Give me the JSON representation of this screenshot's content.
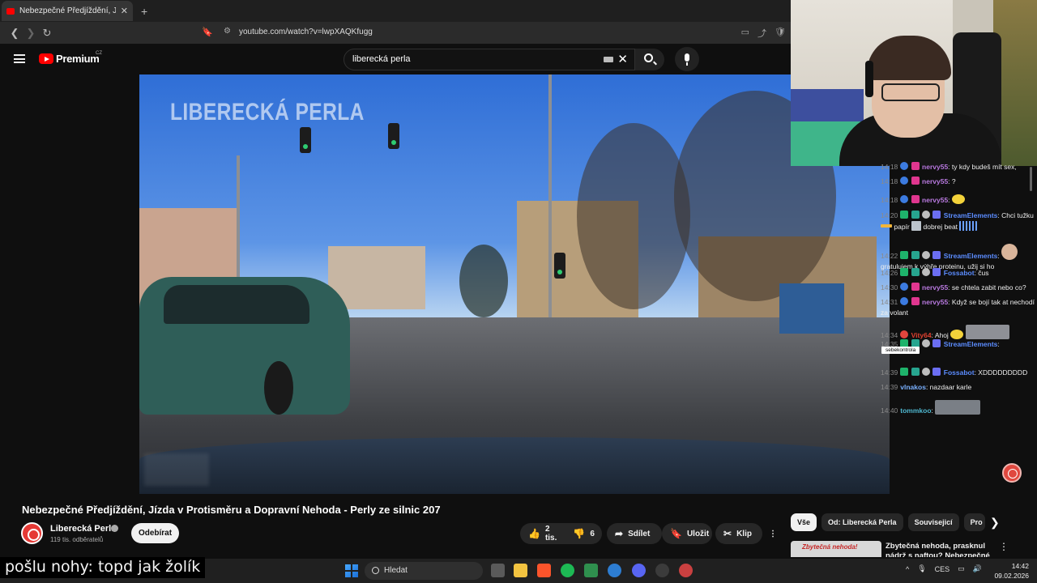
{
  "browser": {
    "tab_title": "Nebezpečné Předjíždění, Jízd",
    "tab_close": "✕",
    "new_tab": "+",
    "url": "youtube.com/watch?v=lwpXAQKfugg",
    "nav_back": "❮",
    "nav_forward": "❯",
    "nav_reload": "↻",
    "bookmark": "🔖",
    "tune": "⚙",
    "right_icons": [
      "▭",
      "⤴",
      "🛡"
    ]
  },
  "youtube": {
    "logo_text": "Premium",
    "country": "CZ",
    "search_value": "liberecká perla",
    "search_clear": "✕"
  },
  "video": {
    "watermark": "LIBERECKÁ PERLA",
    "title": "Nebezpečné Předjíždění, Jízda v Protisměru a Dopravní Nehoda - Perly ze silnic 207",
    "channel": "Liberecká Perla",
    "subscribers": "119 tis. odběratelů",
    "subscribe_label": "Odebírat",
    "likes": "2 tis.",
    "dislikes": "6",
    "share_label": "Sdílet",
    "save_label": "Uložit",
    "clip_label": "Klip",
    "more_label": "⋮",
    "icons": {
      "like": "👍",
      "dislike": "👎",
      "share": "➦",
      "save": "🔖",
      "clip": "✂"
    }
  },
  "chips": [
    "Vše",
    "Od: Liberecká Perla",
    "Souvisejicí",
    "Pro"
  ],
  "chip_next": "❯",
  "recommendation": {
    "thumb_text": "Zbytečná nehoda!",
    "title": "Zbytečná nehoda, prasknul nádrž s naftou? Nebezpečné",
    "menu": "⋮"
  },
  "chat": [
    {
      "time": "14:18",
      "user": "nervy55",
      "text": "ty kdy budeš mít sex,"
    },
    {
      "time": "14:18",
      "user": "nervy55",
      "text": "?"
    },
    {
      "time": "14:18",
      "user": "nervy55",
      "text": ""
    },
    {
      "time": "14:20",
      "user": "StreamElements",
      "text": "Chci tužku",
      "text2": "papír",
      "text3": "dobrej beat"
    },
    {
      "time": "14:22",
      "user": "StreamElements",
      "text": "gratulujem k výhře proteinu, užij si ho"
    },
    {
      "time": "14:26",
      "user": "Fossabot",
      "text": "čus"
    },
    {
      "time": "14:30",
      "user": "nervy55",
      "text": "se chtela zabit nebo co?"
    },
    {
      "time": "14:31",
      "user": "nervy55",
      "text": "Když se bojí tak at nechodí za volant"
    },
    {
      "time": "14:34",
      "user": "Vity64",
      "text": "Ahoj"
    },
    {
      "time": "14:35",
      "user": "StreamElements",
      "text": ""
    },
    {
      "time": "14:39",
      "user": "Fossabot",
      "text": "XDDDDDDDDD"
    },
    {
      "time": "14:39",
      "user": "vlnakos",
      "text": "nazdaar karle"
    },
    {
      "time": "14:40",
      "user": "tommkoo",
      "text": ""
    }
  ],
  "chat_tooltip": "sebekontrola",
  "caption": "pošlu nohy: topd jak žolík",
  "taskbar": {
    "search_placeholder": "Hledat",
    "language": "CES",
    "time": "14:42",
    "date": "09.02.2026",
    "tray_chevron": "^"
  },
  "colors": {
    "youtube_red": "#ff0000",
    "background": "#0f0f0f",
    "chip_active": "#f1f1f1"
  }
}
